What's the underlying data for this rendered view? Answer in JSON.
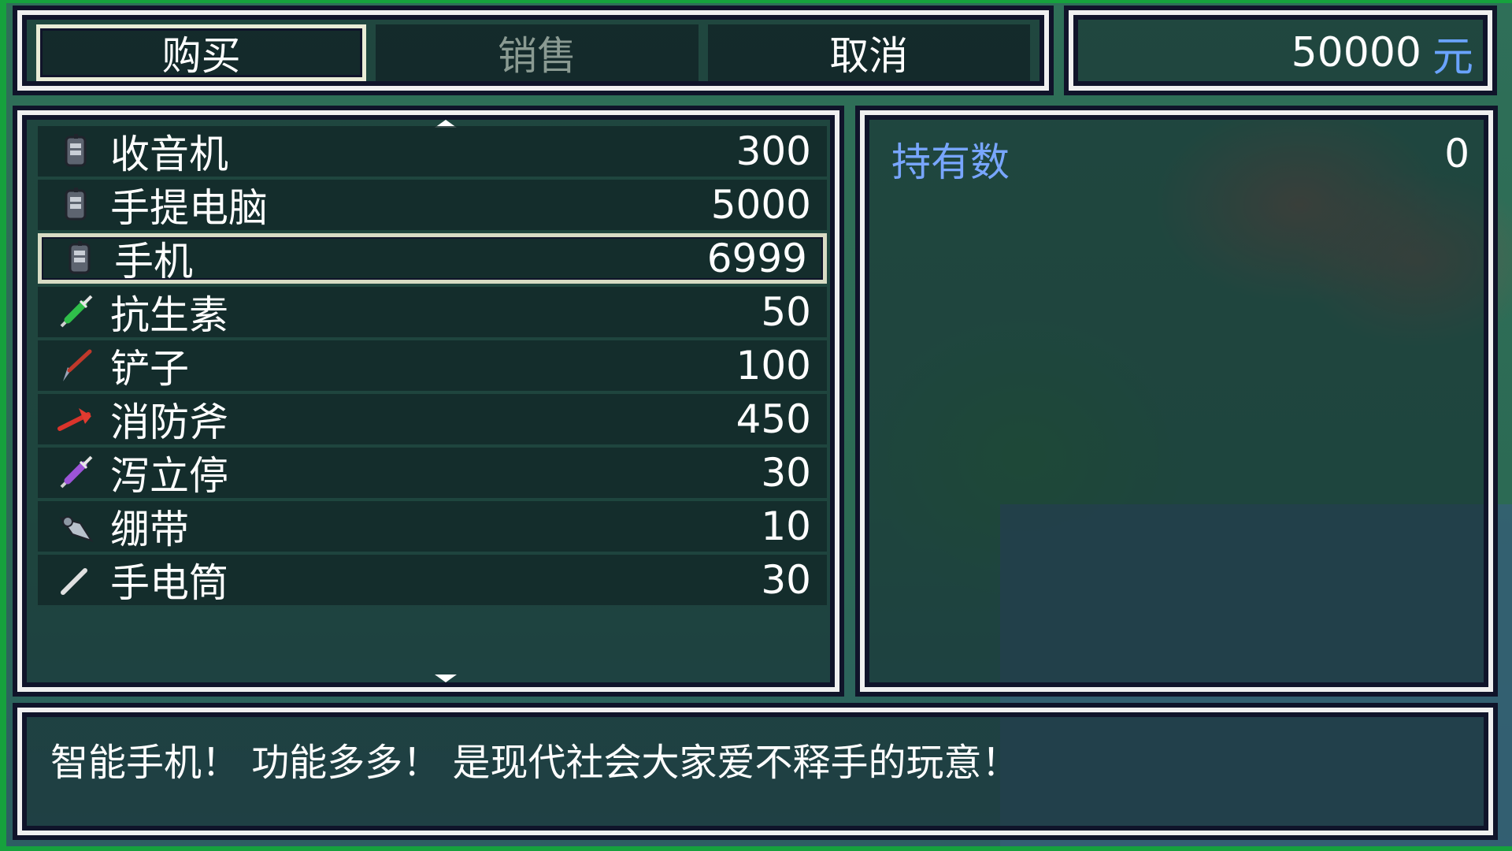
{
  "commands": [
    {
      "label": "购买",
      "state": "selected"
    },
    {
      "label": "销售",
      "state": "disabled"
    },
    {
      "label": "取消",
      "state": "normal"
    }
  ],
  "gold": {
    "value": "50000",
    "unit": "元"
  },
  "items": [
    {
      "name": "收音机",
      "price": "300",
      "icon": "phone-icon"
    },
    {
      "name": "手提电脑",
      "price": "5000",
      "icon": "phone-icon"
    },
    {
      "name": "手机",
      "price": "6999",
      "icon": "phone-icon",
      "selected": true
    },
    {
      "name": "抗生素",
      "price": "50",
      "icon": "syringe-green-icon"
    },
    {
      "name": "铲子",
      "price": "100",
      "icon": "shovel-icon"
    },
    {
      "name": "消防斧",
      "price": "450",
      "icon": "axe-icon"
    },
    {
      "name": "泻立停",
      "price": "30",
      "icon": "syringe-purple-icon"
    },
    {
      "name": "绷带",
      "price": "10",
      "icon": "bandage-icon"
    },
    {
      "name": "手电筒",
      "price": "30",
      "icon": "flashlight-icon"
    }
  ],
  "status": {
    "possession_label": "持有数",
    "possession_value": "0"
  },
  "help": {
    "text": "智能手机！ 功能多多！ 是现代社会大家爱不释手的玩意！"
  },
  "colors": {
    "system_blue": "#78a6ff",
    "window_border": "#f0f0f0",
    "disabled_text": "#8a9a92"
  }
}
